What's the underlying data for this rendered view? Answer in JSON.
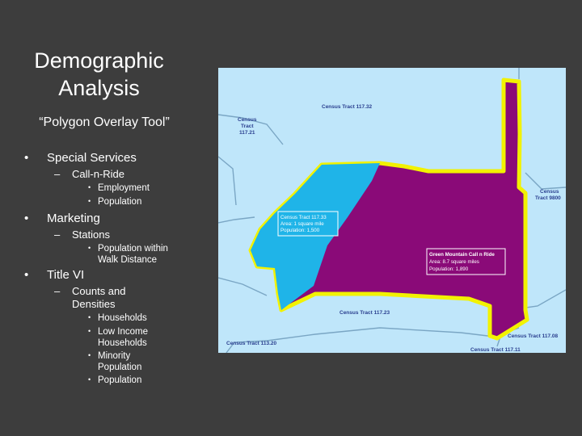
{
  "slide": {
    "title_line1": "Demographic",
    "title_line2": "Analysis",
    "subtitle": "“Polygon Overlay Tool”"
  },
  "bullets": {
    "special_services": "Special Services",
    "call_n_ride": "Call-n-Ride",
    "employment": "Employment",
    "population_1": "Population",
    "marketing": "Marketing",
    "stations": "Stations",
    "population_walk_line1": "Population within",
    "population_walk_line2": "Walk Distance",
    "title_vi": "Title VI",
    "counts_line1": "Counts and",
    "counts_line2": "Densities",
    "households": "Households",
    "low_income_line1": "Low Income",
    "low_income_line2": "Households",
    "minority_line1": "Minority",
    "minority_line2": "Population",
    "population_2": "Population",
    "bullet_glyph": "•",
    "sub_glyph": "–"
  },
  "map": {
    "colors": {
      "background": "#bfe6fa",
      "roads": "#7aa6c4",
      "outline": "#f2f200",
      "purple": "#8a0a78",
      "blue": "#1fb4e8",
      "label_text": "#2a3f8f"
    },
    "labels": {
      "tract_117_32": "Census Tract 117.32",
      "tract_117_21_l1": "Census",
      "tract_117_21_l2": "Tract",
      "tract_117_21_l3": "117.21",
      "tract_9800_l1": "Census",
      "tract_9800_l2": "Tract 9800",
      "tract_117_23": "Census Tract 117.23",
      "tract_117_08": "Census Tract 117.08",
      "tract_117_11": "Census Tract 117.11",
      "tract_113_20": "Census Tract 113.20"
    },
    "box_blue": {
      "line1": "Census Tract 117.33",
      "line2": "Area: 1 square mile",
      "line3": "Population: 1,500"
    },
    "box_purple": {
      "line1": "Green Mountain Call n Ride",
      "line2": "Area: 8.7 square miles",
      "line3": "Population: 1,890"
    }
  }
}
